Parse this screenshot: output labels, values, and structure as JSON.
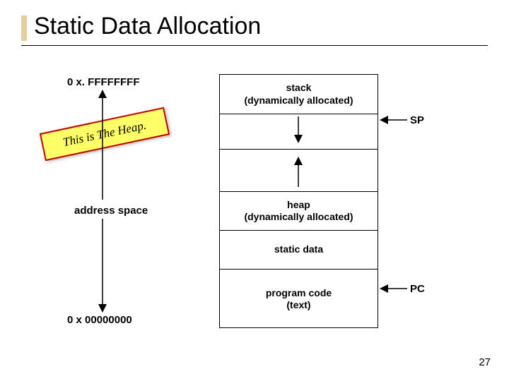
{
  "title": "Static Data Allocation",
  "addresses": {
    "top": "0 x. FFFFFFFF",
    "bottom": "0 x 00000000"
  },
  "labels": {
    "address_space": "address space",
    "sp": "SP",
    "pc": "PC"
  },
  "segments": {
    "stack": {
      "line1": "stack",
      "line2": "(dynamically allocated)"
    },
    "heap": {
      "line1": "heap",
      "line2": "(dynamically allocated)"
    },
    "static": {
      "line1": "static data"
    },
    "text": {
      "line1": "program code",
      "line2": "(text)"
    }
  },
  "callout": "This is The Heap.",
  "page_number": "27"
}
